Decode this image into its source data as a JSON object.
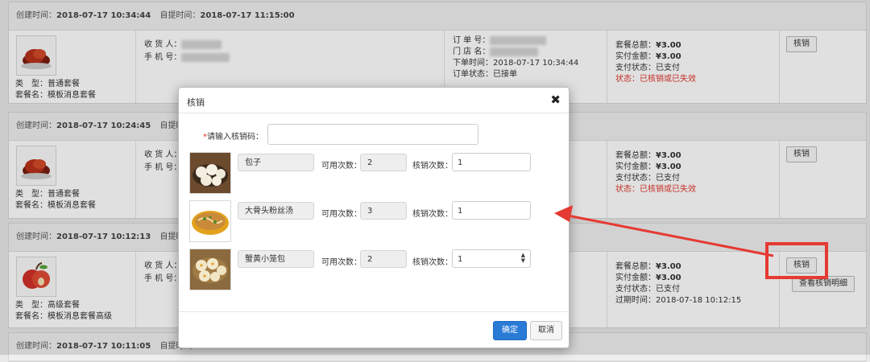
{
  "orders": [
    {
      "created_label": "创建时间：",
      "created_value": "2018-07-17 10:34:44",
      "pickup_label": "自提时间：",
      "pickup_value": "2018-07-17 11:15:00",
      "receiver_label": "收 货 人：",
      "phone_label": "手 机 号：",
      "type_label": "类　型：",
      "type_value": "普通套餐",
      "package_label": "套餐名：",
      "package_value": "模板消息套餐",
      "order_no_label": "订 单 号：",
      "store_label": "门 店 名：",
      "order_time_label": "下单时间：",
      "order_time_value": "2018-07-17 10:34:44",
      "order_status_label": "订单状态：",
      "order_status_value": "已接单",
      "total_label": "套餐总额：",
      "total_value": "¥3.00",
      "paid_label": "实付金额：",
      "paid_value": "¥3.00",
      "pay_status_label": "支付状态：",
      "pay_status_value": "已支付",
      "status_label": "状态：",
      "status_value": "已核销或已失效",
      "verify_button": "核销"
    },
    {
      "created_label": "创建时间：",
      "created_value": "2018-07-17 10:24:45",
      "pickup_label": "自提时间：",
      "receiver_label": "收 货 人：",
      "phone_label": "手 机 号：",
      "type_label": "类　型：",
      "type_value": "普通套餐",
      "package_label": "套餐名：",
      "package_value": "模板消息套餐",
      "total_label": "套餐总额：",
      "total_value": "¥3.00",
      "paid_label": "实付金额：",
      "paid_value": "¥3.00",
      "pay_status_label": "支付状态：",
      "pay_status_value": "已支付",
      "status_label": "状态：",
      "status_value": "已核销或已失效",
      "verify_button": "核销"
    },
    {
      "created_label": "创建时间：",
      "created_value": "2018-07-17 10:12:13",
      "pickup_label": "自提时间：",
      "receiver_label": "收 货 人：",
      "phone_label": "手 机 号：",
      "type_label": "类　型：",
      "type_value": "高级套餐",
      "package_label": "套餐名：",
      "package_value": "模板消息套餐高级",
      "total_label": "套餐总额：",
      "total_value": "¥3.00",
      "paid_label": "实付金额：",
      "paid_value": "¥3.00",
      "pay_status_label": "支付状态：",
      "pay_status_value": "已支付",
      "expire_label": "过期时间：",
      "expire_value": "2018-07-18 10:12:15",
      "verify_button": "核销",
      "detail_button": "查看核销明细"
    },
    {
      "created_label": "创建时间：",
      "created_value": "2018-07-17 10:11:05",
      "pickup_label": "自提时间："
    }
  ],
  "modal": {
    "title": "核销",
    "close_icon": "close-icon",
    "code_required_mark": "*",
    "code_label": "请输入核销码：",
    "code_value": "",
    "available_label": "可用次数：",
    "use_label": "核销次数：",
    "items": [
      {
        "name": "包子",
        "available": "2",
        "use_count": "1",
        "image": "steamed-buns-image"
      },
      {
        "name": "大骨头粉丝汤",
        "available": "3",
        "use_count": "1",
        "image": "noodle-soup-image"
      },
      {
        "name": "蟹黄小笼包",
        "available": "2",
        "use_count": "1",
        "image": "soup-dumplings-image"
      }
    ],
    "confirm_button": "确定",
    "cancel_button": "取消"
  },
  "annotation": {
    "color": "#e53a33"
  }
}
